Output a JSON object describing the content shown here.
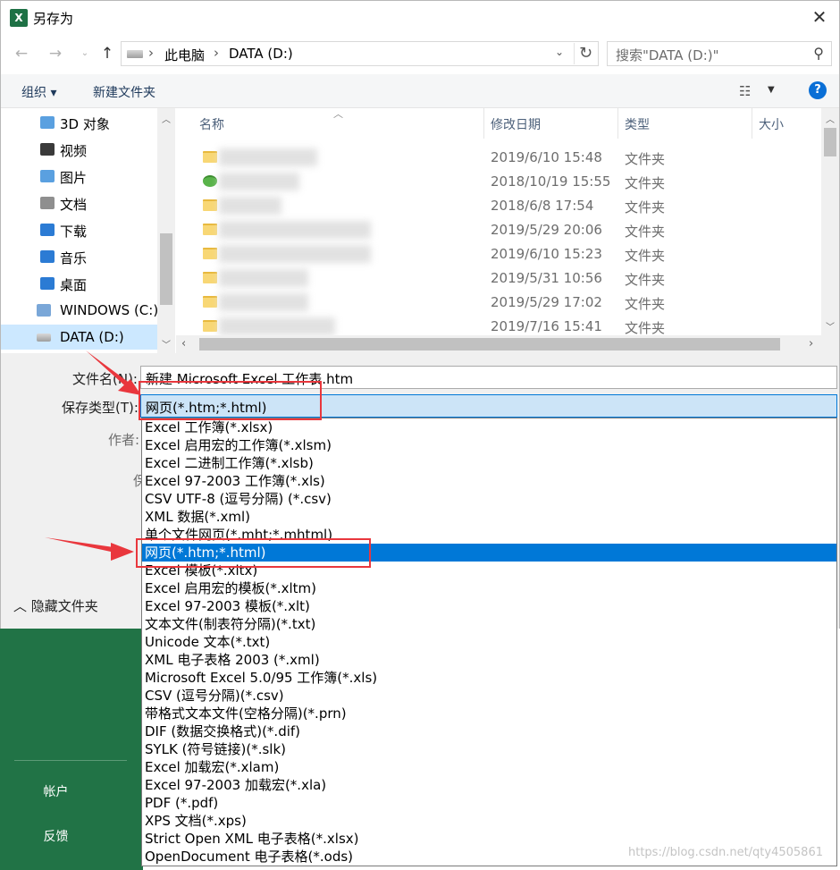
{
  "window": {
    "title": "另存为",
    "app_icon": "excel-icon",
    "close_symbol": "✕"
  },
  "address": {
    "crumbs": [
      "此电脑",
      "DATA (D:)"
    ],
    "search_placeholder": "搜索\"DATA (D:)\""
  },
  "toolbar": {
    "organize": "组织 ▾",
    "new_folder": "新建文件夹",
    "help": "?"
  },
  "nav": {
    "items": [
      {
        "label": "3D 对象",
        "icon": "3d-objects-icon",
        "color": "#5aa0e0"
      },
      {
        "label": "视频",
        "icon": "video-icon",
        "color": "#3a3a3a"
      },
      {
        "label": "图片",
        "icon": "pictures-icon",
        "color": "#5aa0e0"
      },
      {
        "label": "文档",
        "icon": "documents-icon",
        "color": "#8f8f8f"
      },
      {
        "label": "下载",
        "icon": "downloads-icon",
        "color": "#2b7bd4"
      },
      {
        "label": "音乐",
        "icon": "music-icon",
        "color": "#2b7bd4"
      },
      {
        "label": "桌面",
        "icon": "desktop-icon",
        "color": "#2b7bd4"
      },
      {
        "label": "WINDOWS (C:)",
        "icon": "windows-drive-icon",
        "color": "#7aa7d8"
      },
      {
        "label": "DATA (D:)",
        "icon": "drive-icon",
        "color": "#9e9e9e"
      }
    ],
    "selected_index": 8
  },
  "file_list": {
    "columns": [
      "名称",
      "修改日期",
      "类型",
      "大小"
    ],
    "rows": [
      {
        "date": "2019/6/10 15:48",
        "type": "文件夹"
      },
      {
        "date": "2018/10/19 15:55",
        "type": "文件夹"
      },
      {
        "date": "2018/6/8 17:54",
        "type": "文件夹"
      },
      {
        "date": "2019/5/29 20:06",
        "type": "文件夹"
      },
      {
        "date": "2019/6/10 15:23",
        "type": "文件夹"
      },
      {
        "date": "2019/5/31 10:56",
        "type": "文件夹"
      },
      {
        "date": "2019/5/29 17:02",
        "type": "文件夹"
      },
      {
        "date": "2019/7/16 15:41",
        "type": "文件夹"
      }
    ]
  },
  "form": {
    "filename_label": "文件名(N):",
    "filename_value": "新建 Microsoft Excel 工作表.htm",
    "savetype_label": "保存类型(T):",
    "savetype_value": "网页(*.htm;*.html)",
    "author_label": "作者:",
    "partial_label": "保",
    "hide_folders": "隐藏文件夹"
  },
  "dropdown": {
    "items": [
      "Excel 工作簿(*.xlsx)",
      "Excel 启用宏的工作簿(*.xlsm)",
      "Excel 二进制工作簿(*.xlsb)",
      "Excel 97-2003 工作簿(*.xls)",
      "CSV UTF-8 (逗号分隔) (*.csv)",
      "XML 数据(*.xml)",
      "单个文件网页(*.mht;*.mhtml)",
      "网页(*.htm;*.html)",
      "Excel 模板(*.xltx)",
      "Excel 启用宏的模板(*.xltm)",
      "Excel 97-2003 模板(*.xlt)",
      "文本文件(制表符分隔)(*.txt)",
      "Unicode 文本(*.txt)",
      "XML 电子表格 2003 (*.xml)",
      "Microsoft Excel 5.0/95 工作簿(*.xls)",
      "CSV (逗号分隔)(*.csv)",
      "带格式文本文件(空格分隔)(*.prn)",
      "DIF (数据交换格式)(*.dif)",
      "SYLK (符号链接)(*.slk)",
      "Excel 加载宏(*.xlam)",
      "Excel 97-2003 加载宏(*.xla)",
      "PDF (*.pdf)",
      "XPS 文档(*.xps)",
      "Strict Open XML 电子表格(*.xlsx)",
      "OpenDocument 电子表格(*.ods)"
    ],
    "selected_index": 7
  },
  "backstage": {
    "account": "帐户",
    "feedback": "反馈"
  },
  "watermark": "https://blog.csdn.net/qty4505861",
  "colors": {
    "excel_green": "#217346",
    "selection_blue": "#0078d7",
    "annotation_red": "#e9373d"
  }
}
